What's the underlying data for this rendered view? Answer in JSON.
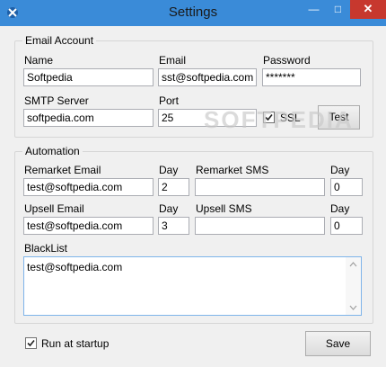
{
  "window": {
    "title": "Settings",
    "minimize_glyph": "—",
    "maximize_glyph": "□",
    "close_glyph": "✕"
  },
  "email_account": {
    "title": "Email Account",
    "name_label": "Name",
    "name_value": "Softpedia",
    "email_label": "Email",
    "email_value": "sst@softpedia.com",
    "password_label": "Password",
    "password_value": "*******",
    "smtp_label": "SMTP Server",
    "smtp_value": "softpedia.com",
    "port_label": "Port",
    "port_value": "25",
    "ssl_label": "SSL",
    "ssl_checked": true,
    "test_label": "Test"
  },
  "automation": {
    "title": "Automation",
    "remarket_email_label": "Remarket Email",
    "remarket_email_value": "test@softpedia.com",
    "remarket_day_label": "Day",
    "remarket_day_value": "2",
    "remarket_sms_label": "Remarket SMS",
    "remarket_sms_value": "",
    "remarket_sms_day_label": "Day",
    "remarket_sms_day_value": "0",
    "upsell_email_label": "Upsell Email",
    "upsell_email_value": "test@softpedia.com",
    "upsell_day_label": "Day",
    "upsell_day_value": "3",
    "upsell_sms_label": "Upsell SMS",
    "upsell_sms_value": "",
    "upsell_sms_day_label": "Day",
    "upsell_sms_day_value": "0",
    "blacklist_label": "BlackList",
    "blacklist_value": "test@softpedia.com"
  },
  "footer": {
    "run_startup_label": "Run at startup",
    "run_startup_checked": true,
    "save_label": "Save"
  },
  "watermark": "SOFTPEDIA",
  "colors": {
    "titlebar": "#3a8bd8",
    "close": "#c7382e",
    "field_border": "#abadb3"
  }
}
